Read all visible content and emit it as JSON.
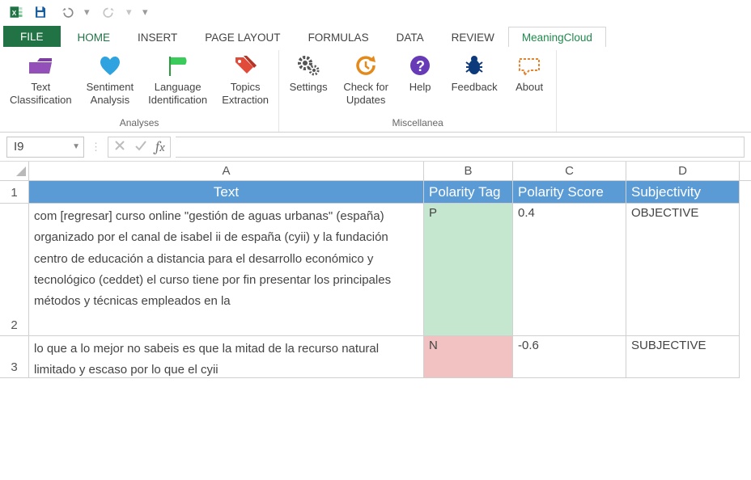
{
  "qat": {
    "save_icon": "save",
    "undo_icon": "undo",
    "redo_icon": "redo"
  },
  "tabs": {
    "file": "FILE",
    "home": "HOME",
    "insert": "INSERT",
    "page_layout": "PAGE LAYOUT",
    "formulas": "FORMULAS",
    "data": "DATA",
    "review": "REVIEW",
    "meaningcloud": "MeaningCloud"
  },
  "ribbon": {
    "analyses": {
      "label": "Analyses",
      "items": [
        {
          "id": "text-classification",
          "label": "Text\nClassification",
          "icon": "folder",
          "color": "#7d3fa0"
        },
        {
          "id": "sentiment-analysis",
          "label": "Sentiment\nAnalysis",
          "icon": "heart",
          "color": "#2fa2e0"
        },
        {
          "id": "language-identification",
          "label": "Language\nIdentification",
          "icon": "flag",
          "color": "#3bcb5a"
        },
        {
          "id": "topics-extraction",
          "label": "Topics\nExtraction",
          "icon": "tags",
          "color": "#e14b3a"
        }
      ]
    },
    "miscellanea": {
      "label": "Miscellanea",
      "items": [
        {
          "id": "settings",
          "label": "Settings",
          "icon": "gears",
          "color": "#555"
        },
        {
          "id": "check-updates",
          "label": "Check for\nUpdates",
          "icon": "history",
          "color": "#e48a1b"
        },
        {
          "id": "help",
          "label": "Help",
          "icon": "question",
          "color": "#673ab7"
        },
        {
          "id": "feedback",
          "label": "Feedback",
          "icon": "bug",
          "color": "#0d3a7a"
        },
        {
          "id": "about",
          "label": "About",
          "icon": "speech",
          "color": "#e8832f"
        }
      ]
    }
  },
  "namebox": {
    "ref": "I9"
  },
  "grid": {
    "col_letters": [
      "A",
      "B",
      "C",
      "D"
    ],
    "headers": {
      "text": "Text",
      "polarity_tag": "Polarity Tag",
      "polarity_score": "Polarity Score",
      "subjectivity": "Subjectivity"
    },
    "rows": [
      {
        "num": "1"
      },
      {
        "num": "2",
        "text": "com [regresar] curso online \"gestión de aguas urbanas\" (españa) organizado por el canal de isabel ii de españa (cyii) y la fundación centro de educación a distancia para el desarrollo económico y tecnológico (ceddet) el curso tiene por fin presentar los principales métodos y técnicas empleados en la",
        "polarity_tag": "P",
        "polarity_score": "0.4",
        "subjectivity": "OBJECTIVE"
      },
      {
        "num": "3",
        "text": "lo que a lo mejor no sabeis es que la mitad de la recurso natural limitado y escaso por lo que el cyii",
        "polarity_tag": "N",
        "polarity_score": "-0.6",
        "subjectivity": "SUBJECTIVE"
      }
    ]
  },
  "colors": {
    "excel_green": "#217346",
    "header_blue": "#5b9bd5",
    "pos_bg": "#c6e7cf",
    "neg_bg": "#f2c2c2"
  }
}
